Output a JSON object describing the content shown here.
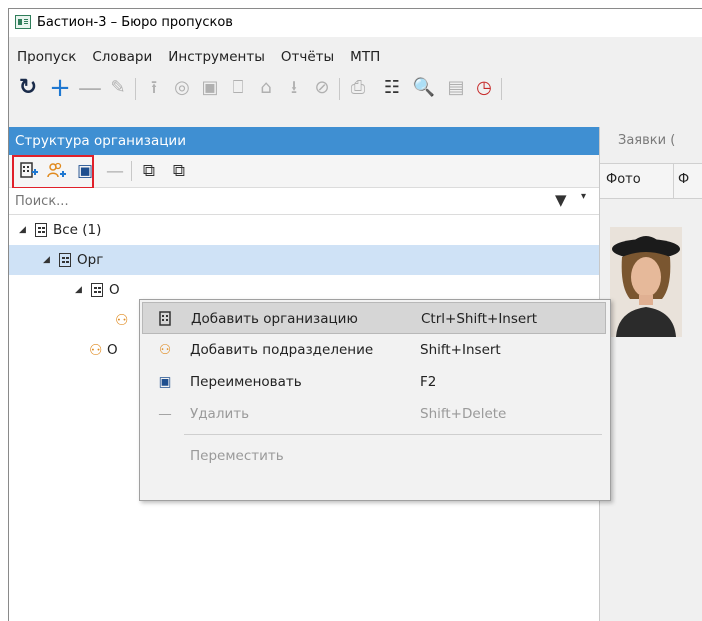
{
  "window": {
    "title": "Бастион-3 – Бюро пропусков",
    "icon": "app-window-icon"
  },
  "menu": [
    "Пропуск",
    "Словари",
    "Инструменты",
    "Отчёты",
    "МТП"
  ],
  "toolbar": {
    "icons": [
      "refresh-icon",
      "add-icon",
      "remove-icon",
      "edit-icon",
      "upload-icon",
      "add-card-icon",
      "card-icon",
      "lock-icon",
      "unlock-icon",
      "download-icon",
      "block-icon",
      "print-icon",
      "scan-icon",
      "search-person-icon",
      "card-list-icon",
      "pass-alert-icon"
    ]
  },
  "left_panel": {
    "header": "Структура организации",
    "search_placeholder": "Поиск...",
    "tree": [
      {
        "label": "Все (1)",
        "level": 0,
        "type": "org"
      },
      {
        "label": "Орг",
        "level": 1,
        "type": "org",
        "selected": true
      },
      {
        "label": "О",
        "level": 2,
        "type": "org"
      },
      {
        "label": "",
        "level": 3,
        "type": "dept"
      },
      {
        "label": "О",
        "level": 1,
        "type": "dept"
      }
    ]
  },
  "right_panel": {
    "tab": "Заявки (",
    "columns": [
      "Фото",
      "Ф"
    ]
  },
  "context_menu": {
    "items": [
      {
        "label": "Добавить организацию",
        "shortcut": "Ctrl+Shift+Insert",
        "icon": "add-organization-icon",
        "hover": true
      },
      {
        "label": "Добавить подразделение",
        "shortcut": "Shift+Insert",
        "icon": "add-department-icon"
      },
      {
        "label": "Переименовать",
        "shortcut": "F2",
        "icon": "rename-icon"
      },
      {
        "label": "Удалить",
        "shortcut": "Shift+Delete",
        "icon": "delete-icon",
        "disabled": true
      },
      {
        "label": "Переместить",
        "shortcut": "",
        "icon": "",
        "disabled": true
      }
    ]
  },
  "colors": {
    "header_bg": "#3f8fd2",
    "selected_row": "#cfe2f6",
    "highlight_box": "#e0202a",
    "accent_blue": "#1f78d1",
    "dept_orange": "#e08a1e"
  }
}
